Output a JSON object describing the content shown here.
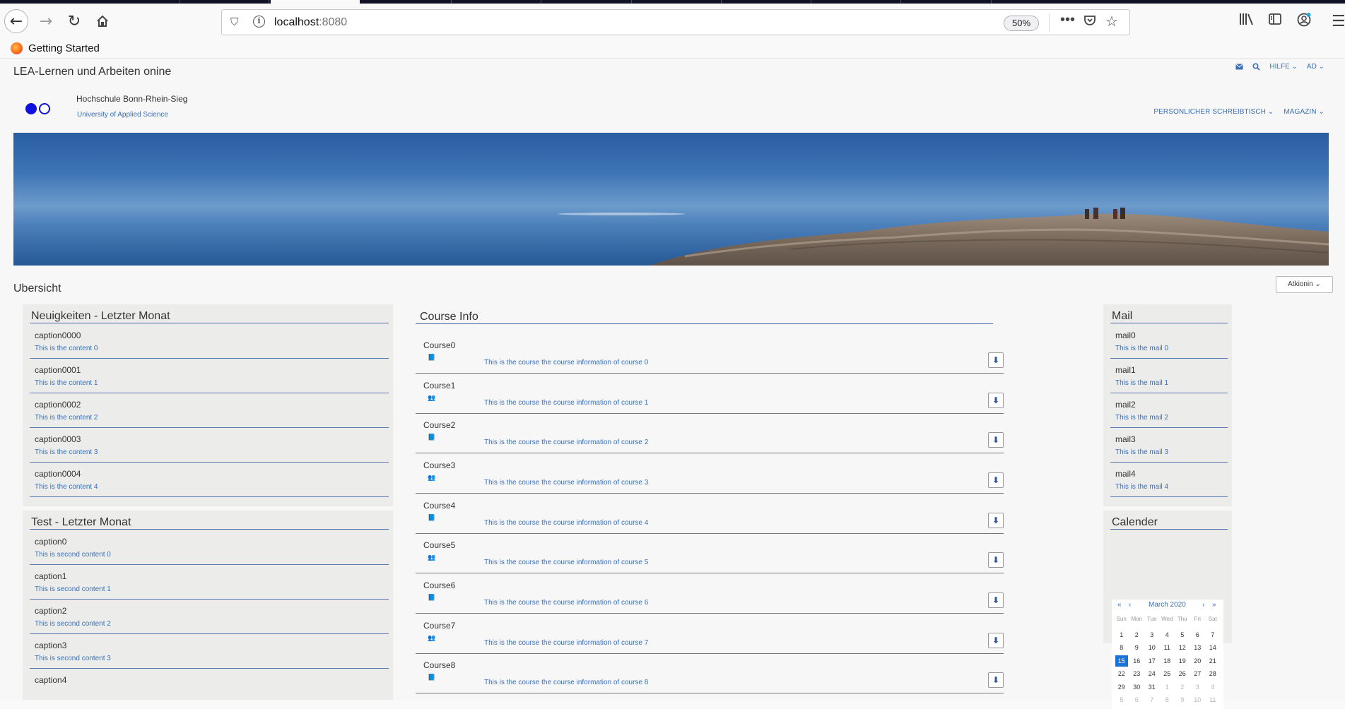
{
  "browser": {
    "url_host": "localhost",
    "url_port": ":8080",
    "zoom": "50%",
    "bookmark": "Getting Started"
  },
  "site": {
    "title": "LEA-Lernen und Arbeiten onine",
    "top_links": [
      "HILFE",
      "AD"
    ],
    "university": "Hochschule Bonn-Rhein-Sieg",
    "university_sub": "University of Applied Science",
    "main_nav": [
      "PERSONLICHER SCHREIBTISCH",
      "MAGAZIN"
    ]
  },
  "overview": {
    "title": "Ubersicht",
    "actions_label": "Atkionin"
  },
  "news": {
    "title": "Neuigkeiten - Letzter Monat",
    "items": [
      {
        "caption": "caption0000",
        "content": "This is the content 0"
      },
      {
        "caption": "caption0001",
        "content": "This is the content 1"
      },
      {
        "caption": "caption0002",
        "content": "This is the content 2"
      },
      {
        "caption": "caption0003",
        "content": "This is the content 3"
      },
      {
        "caption": "caption0004",
        "content": "This is the content 4"
      }
    ]
  },
  "test": {
    "title": "Test - Letzter Monat",
    "items": [
      {
        "caption": "caption0",
        "content": "This is second content 0"
      },
      {
        "caption": "caption1",
        "content": "This is second content 1"
      },
      {
        "caption": "caption2",
        "content": "This is second content 2"
      },
      {
        "caption": "caption3",
        "content": "This is second content 3"
      },
      {
        "caption": "caption4",
        "content": ""
      }
    ]
  },
  "course_info": {
    "title": "Course Info",
    "courses": [
      {
        "name": "Course0",
        "icon": "book-icon",
        "info": "This is the course the course information of course 0"
      },
      {
        "name": "Course1",
        "icon": "group-icon",
        "info": "This is the course the course information of course 1"
      },
      {
        "name": "Course2",
        "icon": "book-icon",
        "info": "This is the course the course information of course 2"
      },
      {
        "name": "Course3",
        "icon": "group-icon",
        "info": "This is the course the course information of course 3"
      },
      {
        "name": "Course4",
        "icon": "book-icon",
        "info": "This is the course the course information of course 4"
      },
      {
        "name": "Course5",
        "icon": "group-icon",
        "info": "This is the course the course information of course 5"
      },
      {
        "name": "Course6",
        "icon": "book-icon",
        "info": "This is the course the course information of course 6"
      },
      {
        "name": "Course7",
        "icon": "group-icon",
        "info": "This is the course the course information of course 7"
      },
      {
        "name": "Course8",
        "icon": "book-icon",
        "info": "This is the course the course information of course 8"
      }
    ]
  },
  "mail": {
    "title": "Mail",
    "items": [
      {
        "caption": "mail0",
        "content": "This is the mail 0"
      },
      {
        "caption": "mail1",
        "content": "This is the mail 1"
      },
      {
        "caption": "mail2",
        "content": "This is the mail 2"
      },
      {
        "caption": "mail3",
        "content": "This is the mail 3"
      },
      {
        "caption": "mail4",
        "content": "This is the mail 4"
      }
    ]
  },
  "calendar": {
    "title": "Calender",
    "month": "March 2020",
    "weekdays": [
      "Sun",
      "Mon",
      "Tue",
      "Wed",
      "Thu",
      "Fri",
      "Sat"
    ],
    "days": [
      "1",
      "2",
      "3",
      "4",
      "5",
      "6",
      "7",
      "8",
      "9",
      "10",
      "11",
      "12",
      "13",
      "14",
      "15",
      "16",
      "17",
      "18",
      "19",
      "20",
      "21",
      "22",
      "23",
      "24",
      "25",
      "26",
      "27",
      "28",
      "29",
      "30",
      "31",
      "1",
      "2",
      "3",
      "4",
      "5",
      "6",
      "7",
      "8",
      "9",
      "10",
      "11"
    ],
    "today": "15"
  },
  "colors": {
    "accent": "#3a6fb8",
    "today": "#1a73d9",
    "logo": "#1010e0"
  }
}
